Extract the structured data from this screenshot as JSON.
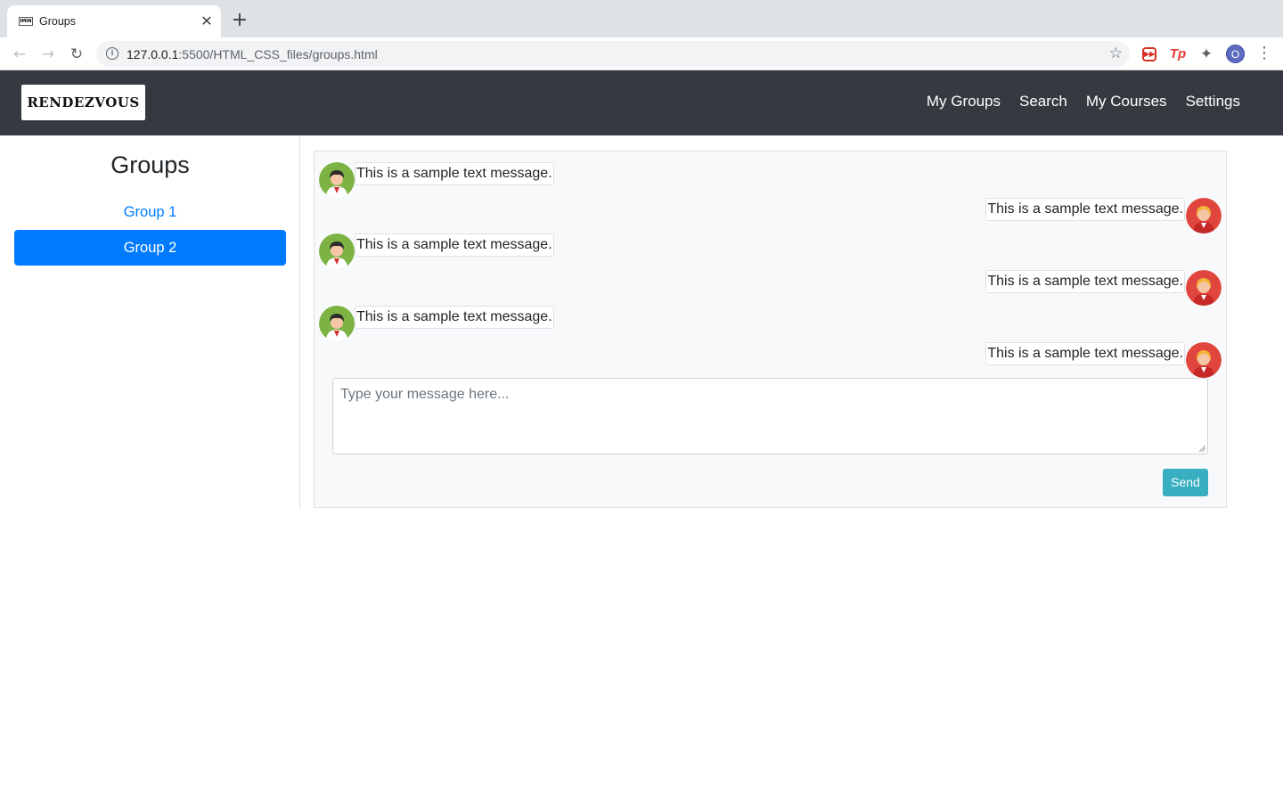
{
  "browser": {
    "tab_title": "Groups",
    "tab_favicon_text": "IMIN",
    "close_glyph": "✕",
    "newtab_glyph": "+",
    "url_host": "127.0.0.1",
    "url_path": ":5500/HTML_CSS_files/groups.html",
    "profile_initial": "O",
    "ext_tp_label": "Tp",
    "icons": [
      "back-arrow-icon",
      "forward-arrow-icon",
      "reload-icon",
      "info-icon",
      "star-icon",
      "media-extension-icon",
      "tp-extension-icon",
      "puzzle-icon",
      "profile-avatar",
      "kebab-menu-icon"
    ]
  },
  "navbar": {
    "brand_text": "RENDEZVOUS",
    "links": [
      "My Groups",
      "Search",
      "My Courses",
      "Settings"
    ],
    "background": "#343a40"
  },
  "sidebar": {
    "title": "Groups",
    "groups": [
      {
        "label": "Group 1",
        "active": false
      },
      {
        "label": "Group 2",
        "active": true
      }
    ],
    "accent": "#007bff"
  },
  "chat": {
    "messages": [
      {
        "side": "left",
        "text": "This is a sample text message.",
        "avatar": "green-avatar-icon"
      },
      {
        "side": "right",
        "text": "This is a sample text message.",
        "avatar": "red-avatar-icon"
      },
      {
        "side": "left",
        "text": "This is a sample text message.",
        "avatar": "green-avatar-icon"
      },
      {
        "side": "right",
        "text": "This is a sample text message.",
        "avatar": "red-avatar-icon"
      },
      {
        "side": "left",
        "text": "This is a sample text message.",
        "avatar": "green-avatar-icon"
      },
      {
        "side": "right",
        "text": "This is a sample text message.",
        "avatar": "red-avatar-icon"
      }
    ],
    "input_placeholder": "Type your message here...",
    "send_label": "Send",
    "send_color": "#17a2b8"
  }
}
